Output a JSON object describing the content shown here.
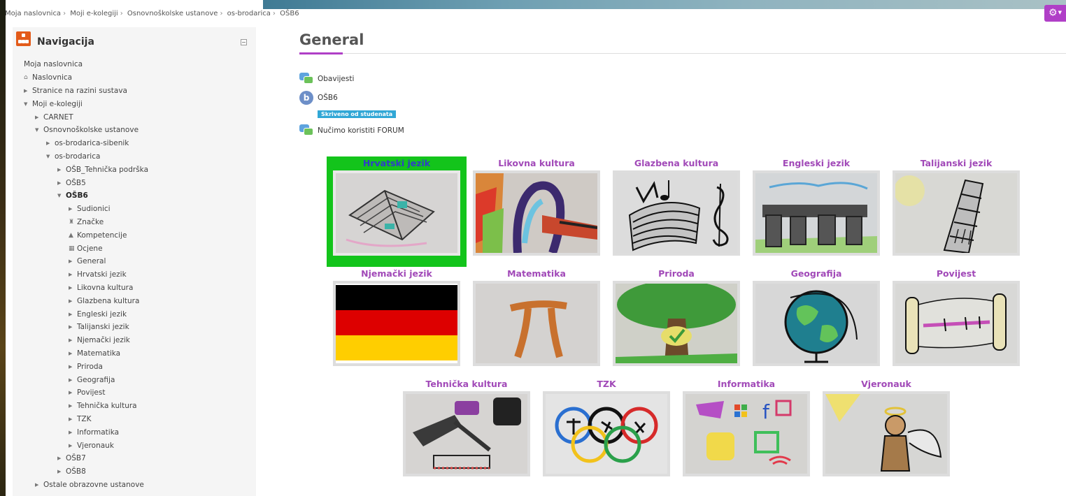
{
  "breadcrumb": [
    "Moja naslovnica",
    "Moji e-kolegiji",
    "Osnovnoškolske ustanove",
    "os-brodarica",
    "OŠB6"
  ],
  "gear_icon": "gear-icon",
  "navigation": {
    "title": "Navigacija",
    "items": [
      {
        "label": "Moja naslovnica",
        "indent": 0,
        "marker": "none"
      },
      {
        "label": "Naslovnica",
        "indent": 0,
        "marker": "home-icon"
      },
      {
        "label": "Stranice na razini sustava",
        "indent": 0,
        "marker": "collapsed"
      },
      {
        "label": "Moji e-kolegiji",
        "indent": 0,
        "marker": "expanded"
      },
      {
        "label": "CARNET",
        "indent": 1,
        "marker": "collapsed"
      },
      {
        "label": "Osnovnoškolske ustanove",
        "indent": 1,
        "marker": "expanded"
      },
      {
        "label": "os-brodarica-sibenik",
        "indent": 2,
        "marker": "collapsed"
      },
      {
        "label": "os-brodarica",
        "indent": 2,
        "marker": "expanded"
      },
      {
        "label": "OŠB_Tehnička podrška",
        "indent": 3,
        "marker": "collapsed"
      },
      {
        "label": "OŠB5",
        "indent": 3,
        "marker": "collapsed"
      },
      {
        "label": "OŠB6",
        "indent": 3,
        "marker": "expanded",
        "bold": true
      },
      {
        "label": "Sudionici",
        "indent": 4,
        "marker": "collapsed"
      },
      {
        "label": "Značke",
        "indent": 4,
        "marker": "trophy-icon"
      },
      {
        "label": "Kompetencije",
        "indent": 4,
        "marker": "competency-icon"
      },
      {
        "label": "Ocjene",
        "indent": 4,
        "marker": "table-icon"
      },
      {
        "label": "General",
        "indent": 4,
        "marker": "collapsed"
      },
      {
        "label": "Hrvatski jezik",
        "indent": 4,
        "marker": "collapsed"
      },
      {
        "label": "Likovna kultura",
        "indent": 4,
        "marker": "collapsed"
      },
      {
        "label": "Glazbena kultura",
        "indent": 4,
        "marker": "collapsed"
      },
      {
        "label": "Engleski jezik",
        "indent": 4,
        "marker": "collapsed"
      },
      {
        "label": "Talijanski jezik",
        "indent": 4,
        "marker": "collapsed"
      },
      {
        "label": "Njemački jezik",
        "indent": 4,
        "marker": "collapsed"
      },
      {
        "label": "Matematika",
        "indent": 4,
        "marker": "collapsed"
      },
      {
        "label": "Priroda",
        "indent": 4,
        "marker": "collapsed"
      },
      {
        "label": "Geografija",
        "indent": 4,
        "marker": "collapsed"
      },
      {
        "label": "Povijest",
        "indent": 4,
        "marker": "collapsed"
      },
      {
        "label": "Tehnička kultura",
        "indent": 4,
        "marker": "collapsed"
      },
      {
        "label": "TZK",
        "indent": 4,
        "marker": "collapsed"
      },
      {
        "label": "Informatika",
        "indent": 4,
        "marker": "collapsed"
      },
      {
        "label": "Vjeronauk",
        "indent": 4,
        "marker": "collapsed"
      },
      {
        "label": "OŠB7",
        "indent": 3,
        "marker": "collapsed"
      },
      {
        "label": "OŠB8",
        "indent": 3,
        "marker": "collapsed"
      },
      {
        "label": "Ostale obrazovne ustanove",
        "indent": 1,
        "marker": "collapsed"
      }
    ]
  },
  "main": {
    "title": "General",
    "activities": [
      {
        "label": "Obavijesti",
        "icon": "forum-icon"
      },
      {
        "label": "OŠB6",
        "icon": "bigbluebutton-icon"
      },
      {
        "label": "Nučimo koristiti FORUM",
        "icon": "forum-icon"
      }
    ],
    "hidden_badge": "Skriveno od studenata",
    "tiles": [
      {
        "label": "Hrvatski jezik",
        "image": "book-drawing",
        "active": true
      },
      {
        "label": "Likovna kultura",
        "image": "paint-drawing"
      },
      {
        "label": "Glazbena kultura",
        "image": "music-drawing"
      },
      {
        "label": "Engleski jezik",
        "image": "stonehenge-drawing"
      },
      {
        "label": "Talijanski jezik",
        "image": "pisa-tower-drawing"
      },
      {
        "label": "Njemački jezik",
        "image": "german-flag"
      },
      {
        "label": "Matematika",
        "image": "pi-drawing"
      },
      {
        "label": "Priroda",
        "image": "tree-drawing"
      },
      {
        "label": "Geografija",
        "image": "globe-drawing"
      },
      {
        "label": "Povijest",
        "image": "scroll-drawing"
      },
      {
        "label": "Tehnička kultura",
        "image": "tools-drawing"
      },
      {
        "label": "TZK",
        "image": "olympic-rings-drawing"
      },
      {
        "label": "Informatika",
        "image": "computer-symbols-drawing"
      },
      {
        "label": "Vjeronauk",
        "image": "angel-drawing"
      }
    ]
  },
  "colors": {
    "accent": "#b03fc7",
    "active_tile": "#13c41b",
    "tile_label": "#a149b8",
    "active_label": "#2e3ec8",
    "nav_icon": "#e35b1a"
  }
}
